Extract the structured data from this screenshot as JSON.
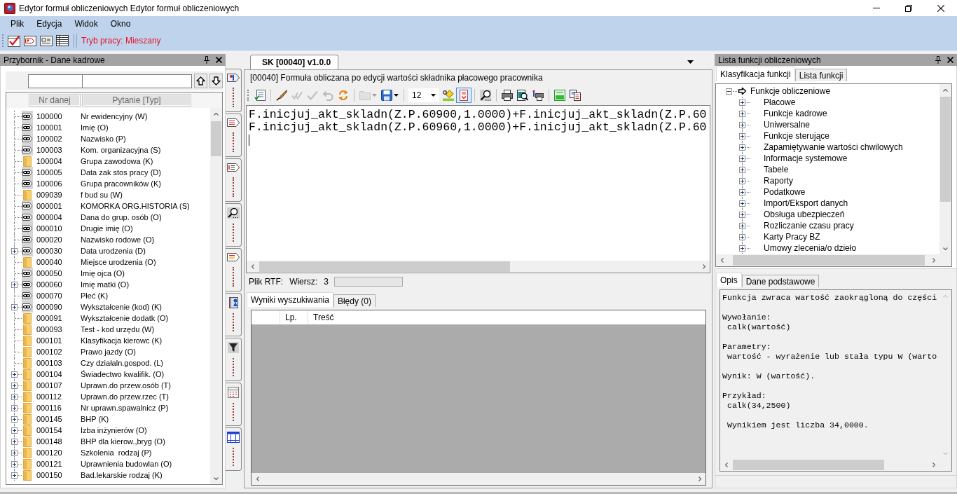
{
  "window": {
    "title": "Edytor formuł obliczeniowych Edytor formuł obliczeniowych"
  },
  "menu": [
    "Plik",
    "Edycja",
    "Widok",
    "Okno"
  ],
  "main_toolbar": {
    "mode_label": "Tryb pracy: Mieszany"
  },
  "toolbox": {
    "title": "Przybornik - Dane kadrowe",
    "columns": [
      "Nr danej",
      "Pytanie [Typ]"
    ],
    "rows": [
      {
        "number": "100000",
        "label": "Nr ewidencyjny (W)",
        "kind": "link",
        "expandable": false
      },
      {
        "number": "100001",
        "label": "Imię (O)",
        "kind": "link",
        "expandable": false
      },
      {
        "number": "100002",
        "label": "Nazwisko (P)",
        "kind": "link",
        "expandable": false
      },
      {
        "number": "100003",
        "label": "Kom. organizacyjna (S)",
        "kind": "link",
        "expandable": false
      },
      {
        "number": "100004",
        "label": "Grupa zawodowa (K)",
        "kind": "folder",
        "expandable": false
      },
      {
        "number": "100005",
        "label": "Data zak stos pracy (D)",
        "kind": "link",
        "expandable": false
      },
      {
        "number": "100006",
        "label": "Grupa pracowników (K)",
        "kind": "link",
        "expandable": false
      },
      {
        "number": "009039",
        "label": "f bud su (W)",
        "kind": "folder",
        "expandable": false
      },
      {
        "number": "000001",
        "label": "KOMORKA ORG.HISTORIA (S)",
        "kind": "link",
        "expandable": false
      },
      {
        "number": "000004",
        "label": "Dana do grup. osób (O)",
        "kind": "link",
        "expandable": false
      },
      {
        "number": "000010",
        "label": "Drugie imię (O)",
        "kind": "link",
        "expandable": false
      },
      {
        "number": "000020",
        "label": "Nazwisko rodowe (O)",
        "kind": "link",
        "expandable": false
      },
      {
        "number": "000030",
        "label": "Data urodzenia (D)",
        "kind": "link",
        "expandable": true
      },
      {
        "number": "000040",
        "label": "Miejsce urodzenia (O)",
        "kind": "folder",
        "expandable": false
      },
      {
        "number": "000050",
        "label": "Imię ojca (O)",
        "kind": "link",
        "expandable": false
      },
      {
        "number": "000060",
        "label": "Imię matki (O)",
        "kind": "link",
        "expandable": true
      },
      {
        "number": "000070",
        "label": "Płeć (K)",
        "kind": "link",
        "expandable": false
      },
      {
        "number": "000090",
        "label": "Wykształcenie (kod) (K)",
        "kind": "link",
        "expandable": true
      },
      {
        "number": "000091",
        "label": "Wykształcenie dodatk (O)",
        "kind": "folder",
        "expandable": false
      },
      {
        "number": "000093",
        "label": "Test - kod urzędu (W)",
        "kind": "folder",
        "expandable": false
      },
      {
        "number": "000101",
        "label": "Klasyfikacja kierowc (K)",
        "kind": "folder",
        "expandable": false
      },
      {
        "number": "000102",
        "label": "Prawo jazdy (O)",
        "kind": "folder",
        "expandable": false
      },
      {
        "number": "000103",
        "label": "Czy działaln.gospod. (L)",
        "kind": "folder",
        "expandable": false
      },
      {
        "number": "000104",
        "label": "Świadectwo kwalifik. (O)",
        "kind": "folder",
        "expandable": true
      },
      {
        "number": "000107",
        "label": "Uprawn.do przew.osób (T)",
        "kind": "folder",
        "expandable": true
      },
      {
        "number": "000112",
        "label": "Uprawn.do przew.rzec (T)",
        "kind": "folder",
        "expandable": true
      },
      {
        "number": "000116",
        "label": "Nr uprawn.spawalnicz (P)",
        "kind": "folder",
        "expandable": true
      },
      {
        "number": "000145",
        "label": "BHP (K)",
        "kind": "folder",
        "expandable": true
      },
      {
        "number": "000154",
        "label": "Izba inżynierów (O)",
        "kind": "folder",
        "expandable": true
      },
      {
        "number": "000148",
        "label": "BHP dla kierow.,bryg (O)",
        "kind": "folder",
        "expandable": true
      },
      {
        "number": "000120",
        "label": "Szkolenia  rodzaj (P)",
        "kind": "folder",
        "expandable": true
      },
      {
        "number": "000121",
        "label": "Uprawnienia budowlan (O)",
        "kind": "folder",
        "expandable": true
      },
      {
        "number": "000150",
        "label": "Bad.lekarskie rodzaj (K)",
        "kind": "folder",
        "expandable": true
      }
    ]
  },
  "editor": {
    "tab": {
      "label": "SK [00040] v1.0.0",
      "selected": true
    },
    "description": "[00040] Formuła obliczana po edycji wartości składnika płacowego pracownika",
    "toolbar": [
      [
        {
          "kind": "properties",
          "disabled": false,
          "pressed": false
        }
      ],
      [
        {
          "kind": "edit",
          "disabled": false,
          "pressed": false
        },
        {
          "kind": "check-all",
          "disabled": true,
          "pressed": false
        },
        {
          "kind": "check",
          "disabled": true,
          "pressed": false
        },
        {
          "kind": "undo",
          "disabled": true,
          "pressed": false
        },
        {
          "kind": "refresh",
          "disabled": false,
          "pressed": false
        }
      ],
      [
        {
          "kind": "open-menu",
          "disabled": true,
          "pressed": false
        },
        {
          "kind": "save-menu",
          "disabled": false,
          "pressed": false
        }
      ],
      [
        {
          "kind": "font-size",
          "value": "12",
          "disabled": false,
          "pressed": false
        },
        {
          "kind": "highlight",
          "disabled": false,
          "pressed": false
        },
        {
          "kind": "document",
          "disabled": false,
          "pressed": true
        }
      ],
      [
        {
          "kind": "find",
          "disabled": false,
          "pressed": false
        }
      ],
      [
        {
          "kind": "print",
          "disabled": false,
          "pressed": false
        },
        {
          "kind": "preview",
          "disabled": false,
          "pressed": false
        },
        {
          "kind": "print-setup",
          "disabled": false,
          "pressed": false
        }
      ],
      [
        {
          "kind": "sql",
          "disabled": false,
          "pressed": false
        },
        {
          "kind": "copy",
          "disabled": false,
          "pressed": false
        }
      ]
    ],
    "lines": [
      "F.inicjuj_akt_skladn(Z.P.60900,1.0000)+F.inicjuj_akt_skladn(Z.P.60",
      "F.inicjuj_akt_skladn(Z.P.60960,1.0000)+F.inicjuj_akt_skladn(Z.P.60"
    ],
    "status": {
      "file_label": "Plik RTF:",
      "row_label": "Wiersz:",
      "row_value": "3",
      "field": {
        "disabled": true
      }
    },
    "result_tabs": [
      {
        "label": "Wyniki wyszukiwania",
        "selected": true
      },
      {
        "label": "Błędy (0)",
        "selected": false
      }
    ],
    "grid": {
      "columns": [
        "Lp.",
        "Treść"
      ]
    }
  },
  "functions": {
    "title": "Lista funkcji obliczeniowych",
    "tabs": [
      {
        "label": "Klasyfikacja funkcji",
        "selected": true
      },
      {
        "label": "Lista funkcji",
        "selected": false
      }
    ],
    "tree": [
      {
        "label": "Funkcje obliczeniowe",
        "expanded": true,
        "children": [
          {
            "label": "Płacowe",
            "expanded": false
          },
          {
            "label": "Funkcje kadrowe",
            "expanded": false
          },
          {
            "label": "Uniwersalne",
            "expanded": false
          },
          {
            "label": "Funkcje sterujące",
            "expanded": false
          },
          {
            "label": "Zapamiętywanie wartości chwilowych",
            "expanded": false
          },
          {
            "label": "Informacje systemowe",
            "expanded": false
          },
          {
            "label": "Tabele",
            "expanded": false
          },
          {
            "label": "Raporty",
            "expanded": false
          },
          {
            "label": "Podatkowe",
            "expanded": false
          },
          {
            "label": "Import/Eksport danych",
            "expanded": false
          },
          {
            "label": "Obsługa ubezpieczeń",
            "expanded": false
          },
          {
            "label": "Rozliczanie czasu pracy",
            "expanded": false
          },
          {
            "label": "Karty Pracy BZ",
            "expanded": false
          },
          {
            "label": "Umowy zlecenia/o dzieło",
            "expanded": false
          }
        ]
      }
    ],
    "info_tabs": [
      {
        "label": "Opis",
        "selected": true
      },
      {
        "label": "Dane podstawowe",
        "selected": false
      }
    ],
    "description": [
      [
        "Funkcja zwraca wartość zaokrągloną do części"
      ],
      [
        "Wywołanie:",
        " calk(wartość)"
      ],
      [
        "Parametry:",
        " wartość - wyrażenie lub stała typu W (warto"
      ],
      [
        "Wynik: W (wartość)."
      ],
      [
        "Przykład:",
        " calk(34,2500)"
      ],
      [
        " Wynikiem jest liczba 34,0000."
      ]
    ]
  }
}
